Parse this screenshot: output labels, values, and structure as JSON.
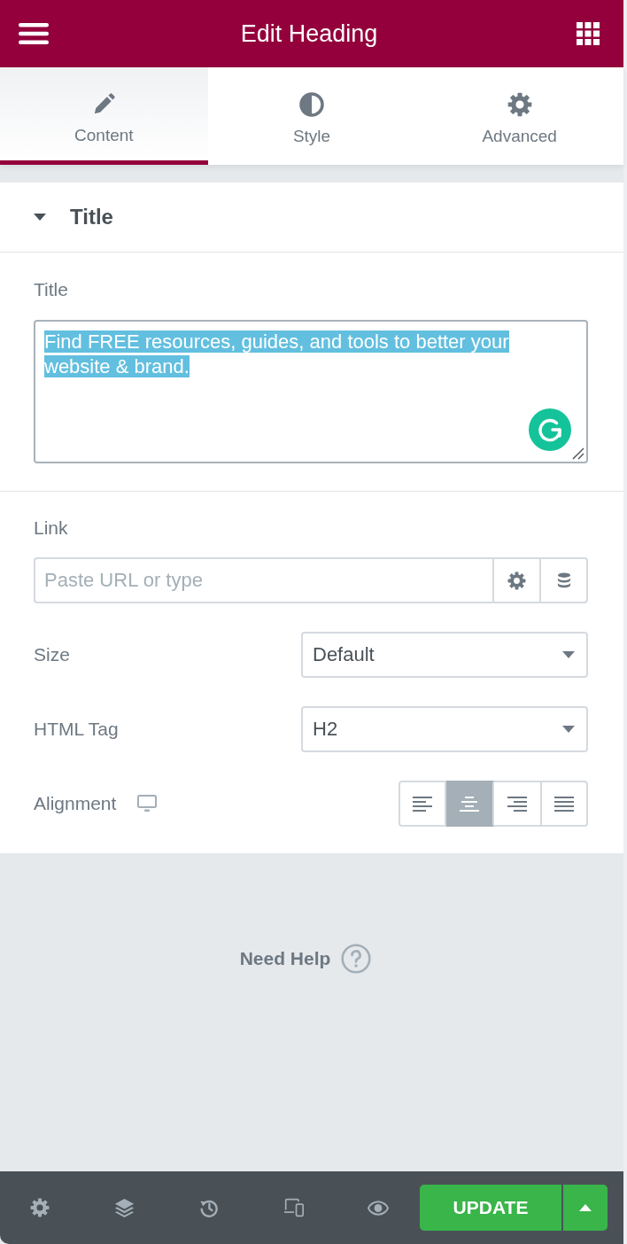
{
  "header": {
    "title": "Edit Heading"
  },
  "tabs": [
    {
      "label": "Content",
      "kind": "pencil",
      "selected": true
    },
    {
      "label": "Style",
      "kind": "contrast",
      "selected": false
    },
    {
      "label": "Advanced",
      "kind": "gear",
      "selected": false
    }
  ],
  "section": {
    "title": "Title",
    "expanded": true,
    "title_control": {
      "label": "Title",
      "value": "Find FREE resources, guides, and tools to better your website & brand.",
      "highlighted": true
    },
    "link_control": {
      "label": "Link",
      "placeholder": "Paste URL or type"
    },
    "size_control": {
      "label": "Size",
      "value": "Default"
    },
    "html_tag_control": {
      "label": "HTML Tag",
      "value": "H2"
    },
    "alignment_control": {
      "label": "Alignment",
      "options": [
        {
          "kind": "left",
          "selected": false
        },
        {
          "kind": "center",
          "selected": true
        },
        {
          "kind": "right",
          "selected": false
        },
        {
          "kind": "justify",
          "selected": false
        }
      ]
    }
  },
  "help": {
    "label": "Need Help"
  },
  "footer": {
    "update_label": "UPDATE"
  }
}
